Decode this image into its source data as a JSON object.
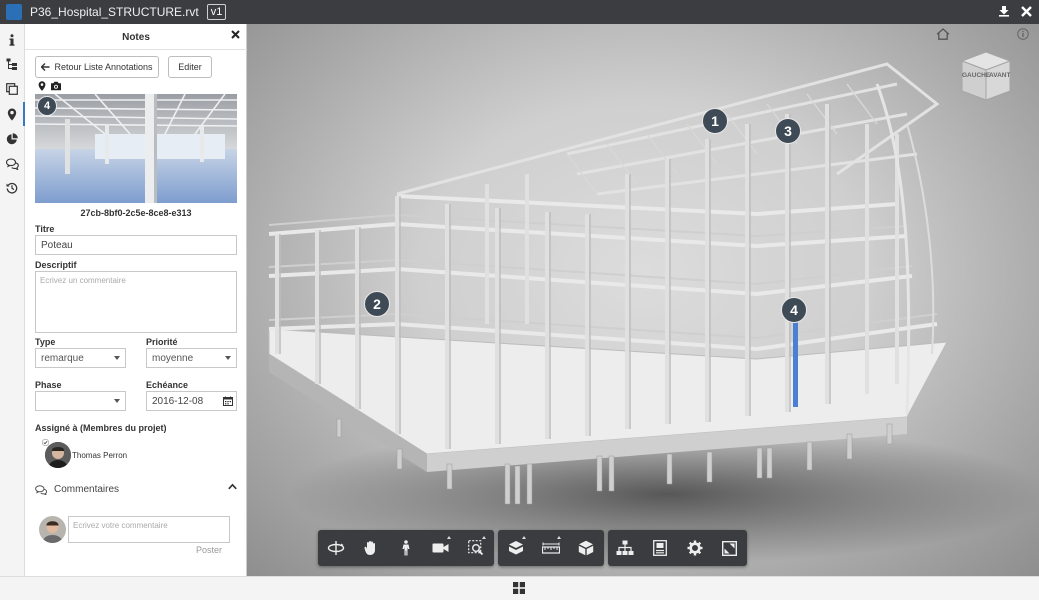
{
  "titlebar": {
    "filename": "P36_Hospital_STRUCTURE.rvt",
    "version": "v1",
    "download_icon": "download-icon",
    "close_icon": "close-icon"
  },
  "sidebar": {
    "icons": [
      "info-icon",
      "model-tree-icon",
      "sheets-icon",
      "location-pin-icon",
      "properties-pie-icon",
      "comments-icon",
      "history-icon"
    ],
    "active_index": 3
  },
  "notes_panel": {
    "title": "Notes",
    "back_button": "Retour Liste Annotations",
    "edit_button": "Editer",
    "thumbnail_badge": "4",
    "note_id": "27cb-8bf0-2c5e-8ce8-e313",
    "title_label": "Titre",
    "title_value": "Poteau",
    "description_label": "Descriptif",
    "description_placeholder": "Ecrivez un commentaire",
    "type_label": "Type",
    "type_value": "remarque",
    "priority_label": "Priorité",
    "priority_value": "moyenne",
    "phase_label": "Phase",
    "phase_value": "",
    "due_label": "Echéance",
    "due_value": "2016-12-08",
    "assigned_label": "Assigné à (Membres du projet)",
    "assignee_name": "Thomas Perron",
    "comments_label": "Commentaires",
    "comment_placeholder": "Ecrivez votre commentaire",
    "post_button": "Poster"
  },
  "viewer": {
    "markers": [
      "1",
      "2",
      "3",
      "4"
    ],
    "viewcube_left": "GAUCHE",
    "viewcube_front": "AVANT",
    "highlight_color": "#4a7fd4",
    "toolbar_groups": [
      [
        "orbit-icon",
        "pan-icon",
        "walk-icon",
        "camera-icon",
        "zoom-window-icon"
      ],
      [
        "section-icon",
        "measure-icon",
        "explode-icon"
      ],
      [
        "structure-tree-icon",
        "properties-icon",
        "settings-icon",
        "fullscreen-icon"
      ]
    ]
  }
}
